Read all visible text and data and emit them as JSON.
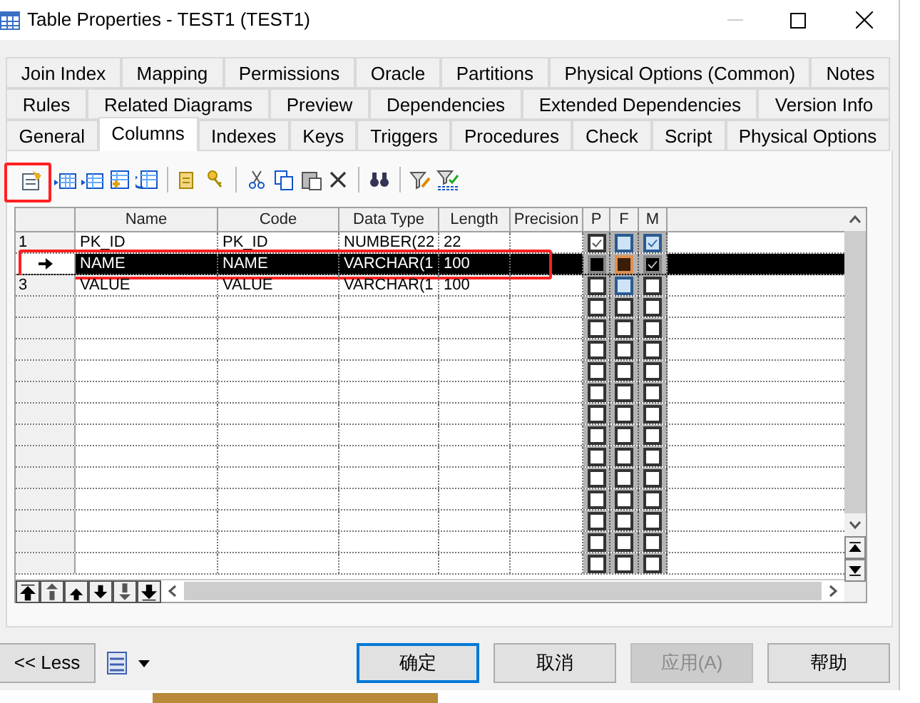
{
  "window": {
    "title": "Table Properties - TEST1 (TEST1)"
  },
  "tab_rows": [
    [
      {
        "label": "Join Index",
        "selected": false
      },
      {
        "label": "Mapping",
        "selected": false
      },
      {
        "label": "Permissions",
        "selected": false
      },
      {
        "label": "Oracle",
        "selected": false
      },
      {
        "label": "Partitions",
        "selected": false
      },
      {
        "label": "Physical Options (Common)",
        "selected": false
      },
      {
        "label": "Notes",
        "selected": false
      }
    ],
    [
      {
        "label": "Rules",
        "selected": false
      },
      {
        "label": "Related Diagrams",
        "selected": false
      },
      {
        "label": "Preview",
        "selected": false
      },
      {
        "label": "Dependencies",
        "selected": false
      },
      {
        "label": "Extended Dependencies",
        "selected": false
      },
      {
        "label": "Version Info",
        "selected": false
      }
    ],
    [
      {
        "label": "General",
        "selected": false
      },
      {
        "label": "Columns",
        "selected": true
      },
      {
        "label": "Indexes",
        "selected": false
      },
      {
        "label": "Keys",
        "selected": false
      },
      {
        "label": "Triggers",
        "selected": false
      },
      {
        "label": "Procedures",
        "selected": false
      },
      {
        "label": "Check",
        "selected": false
      },
      {
        "label": "Script",
        "selected": false
      },
      {
        "label": "Physical Options",
        "selected": false
      }
    ]
  ],
  "grid": {
    "columns": [
      "Name",
      "Code",
      "Data Type",
      "Length",
      "Precision",
      "P",
      "F",
      "M"
    ],
    "rows": [
      {
        "number": "1",
        "name": "PK_ID",
        "code": "PK_ID",
        "data_type": "NUMBER(22",
        "length": "22",
        "primary": true,
        "foreign": false,
        "mandatory": true,
        "selected": false
      },
      {
        "name": "NAME",
        "code": "NAME",
        "data_type": "VARCHAR(1",
        "length": "100",
        "primary": false,
        "foreign": false,
        "mandatory": true,
        "selected": true
      },
      {
        "number": "3",
        "name": "VALUE",
        "code": "VALUE",
        "data_type": "VARCHAR(1",
        "length": "100",
        "primary": false,
        "foreign": false,
        "mandatory": false,
        "selected": false
      }
    ]
  },
  "empty_rows": [
    {
      "primary": false,
      "foreign": false,
      "mandatory": false
    },
    {
      "primary": false,
      "foreign": false,
      "mandatory": false
    },
    {
      "primary": false,
      "foreign": false,
      "mandatory": false
    },
    {
      "primary": false,
      "foreign": false,
      "mandatory": false
    },
    {
      "primary": false,
      "foreign": false,
      "mandatory": false
    },
    {
      "primary": false,
      "foreign": false,
      "mandatory": false
    },
    {
      "primary": false,
      "foreign": false,
      "mandatory": false
    },
    {
      "primary": false,
      "foreign": false,
      "mandatory": false
    },
    {
      "primary": false,
      "foreign": false,
      "mandatory": false
    },
    {
      "primary": false,
      "foreign": false,
      "mandatory": false
    },
    {
      "primary": false,
      "foreign": false,
      "mandatory": false
    },
    {
      "primary": false,
      "foreign": false,
      "mandatory": false
    },
    {
      "primary": false,
      "foreign": false,
      "mandatory": false
    }
  ],
  "buttons": [
    {
      "label": "<< Less",
      "kind": "normal"
    },
    {
      "label": "确定",
      "kind": "default"
    },
    {
      "label": "取消",
      "kind": "normal"
    },
    {
      "label": "应用(A)",
      "kind": "disabled"
    },
    {
      "label": "帮助",
      "kind": "normal"
    }
  ]
}
